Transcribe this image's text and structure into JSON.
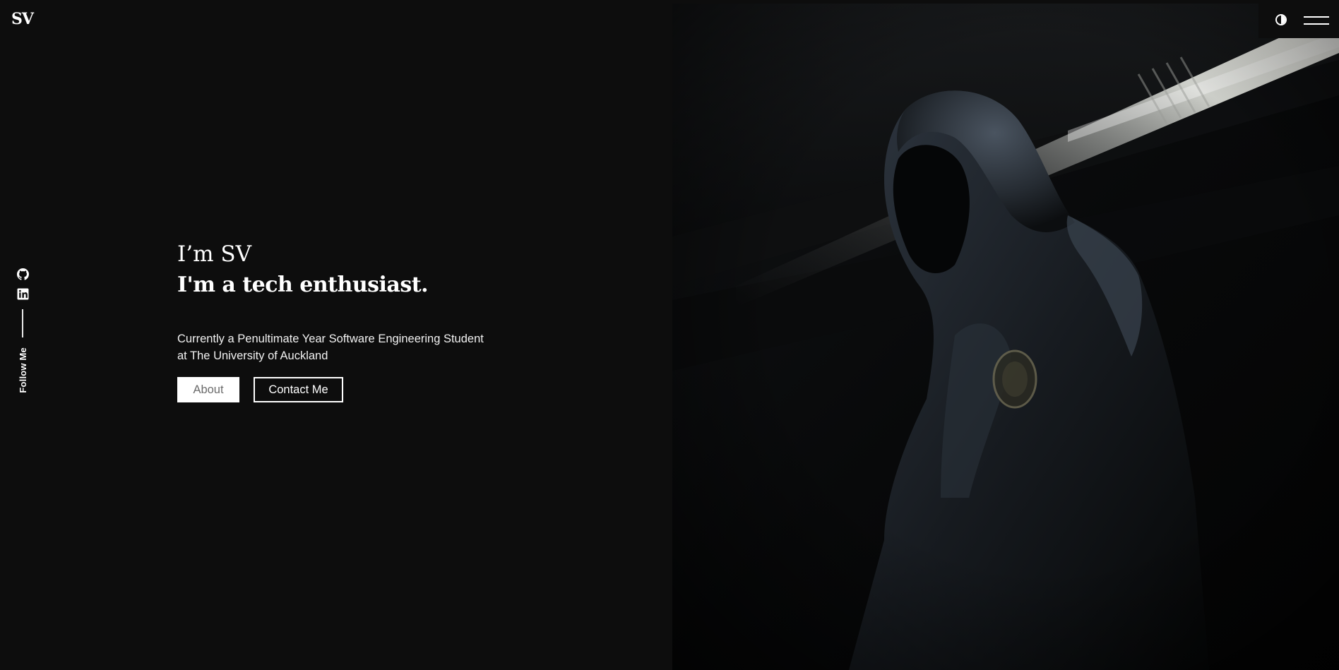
{
  "header": {
    "logo_text": "SV"
  },
  "social": {
    "icons": [
      "github-icon",
      "linkedin-icon"
    ],
    "follow_label": "Follow Me"
  },
  "hero": {
    "greeting": "I’m SV",
    "tagline": "I'm a tech enthusiast.",
    "description_line1": "Currently a Penultimate Year Software Engineering Student",
    "description_line2": "at The University of Auckland",
    "about_button": "About",
    "contact_button": "Contact Me"
  },
  "controls": {
    "theme_toggle_icon": "contrast-icon",
    "menu_icon": "hamburger-menu-icon"
  },
  "colors": {
    "background": "#0d0d0d",
    "text": "#ffffff",
    "about_button_text": "#6b6b6b"
  }
}
